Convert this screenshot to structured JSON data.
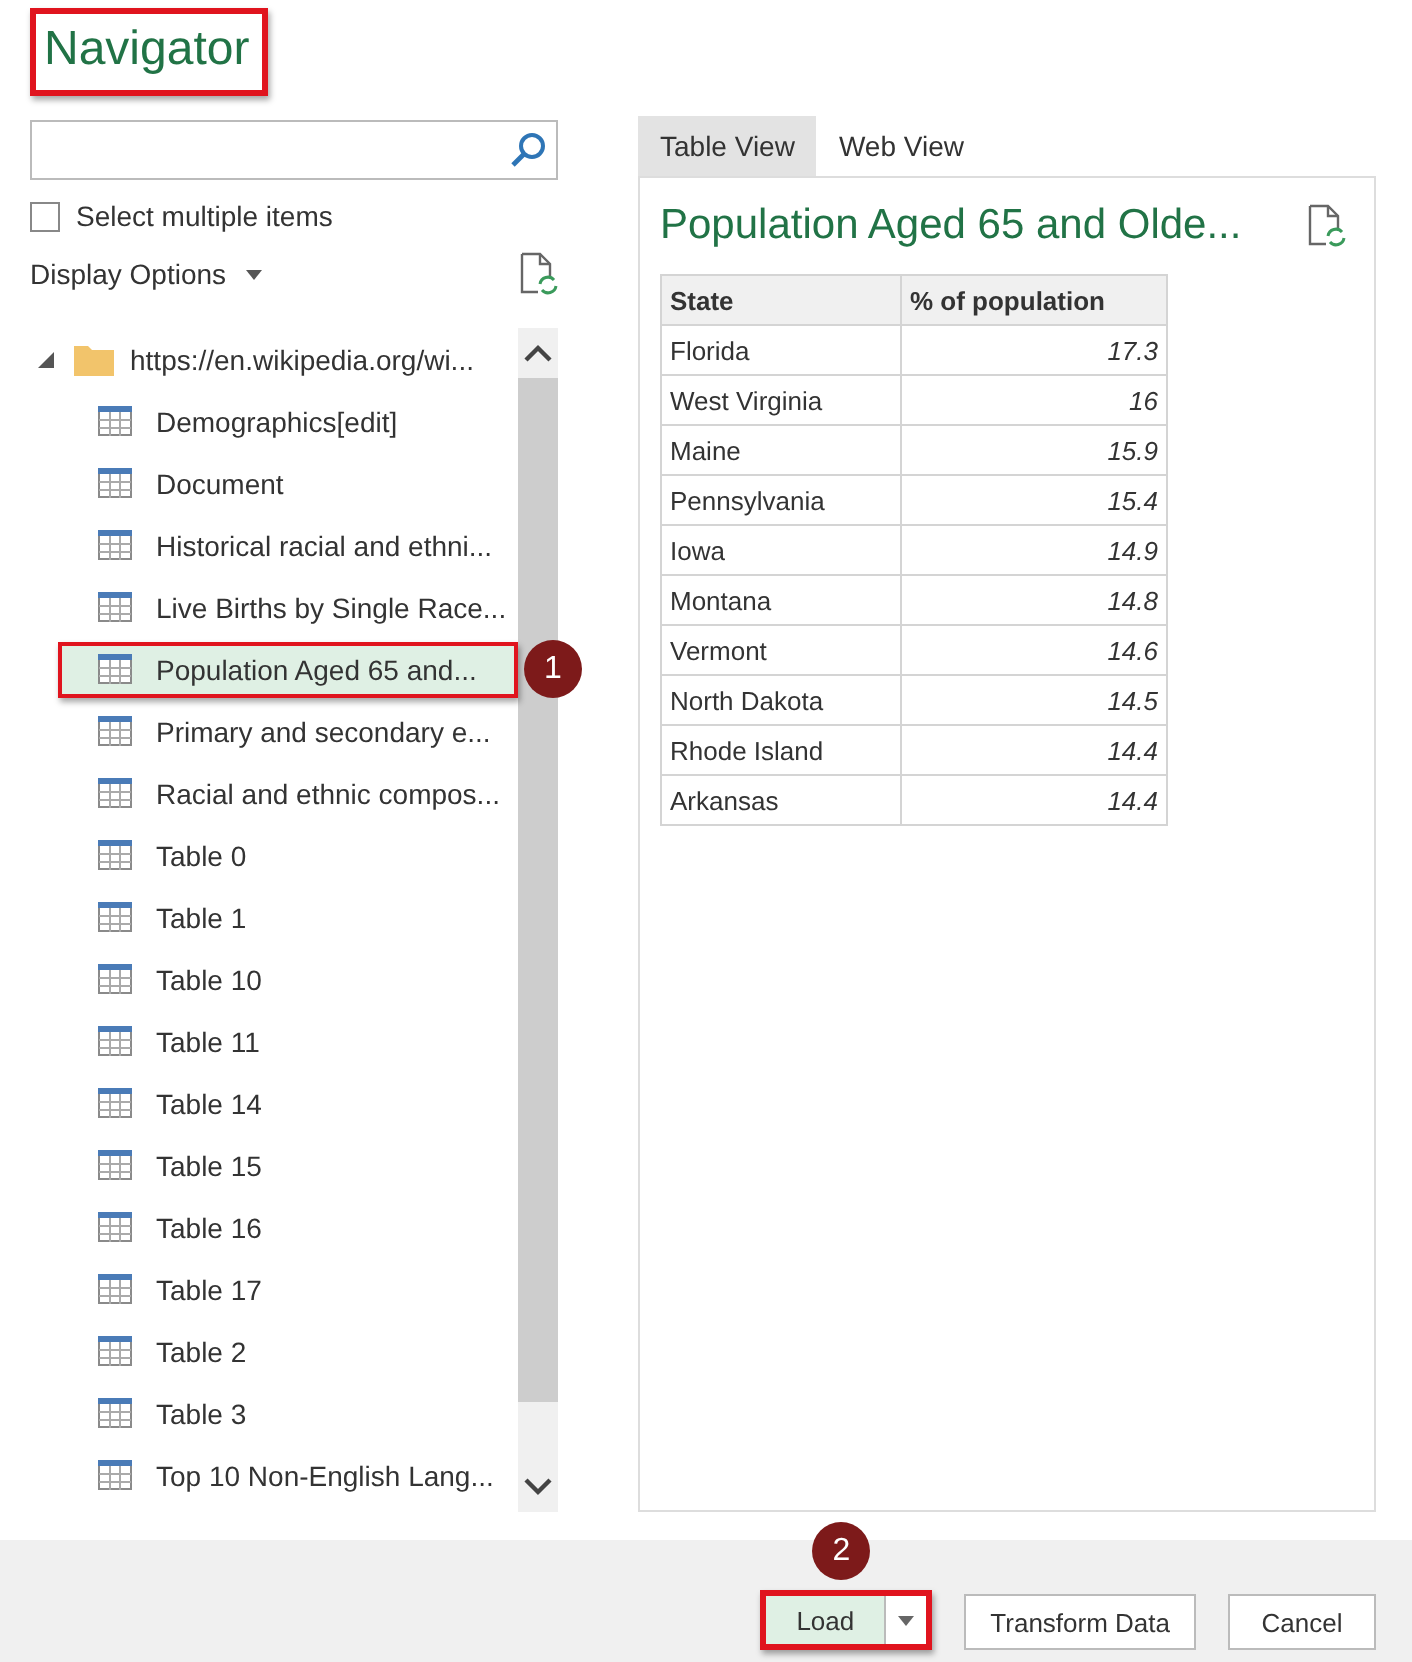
{
  "window": {
    "title": "Navigator",
    "title_highlighted": true
  },
  "select_multiple": {
    "label": "Select multiple items",
    "checked": false
  },
  "display_options": {
    "label": "Display Options"
  },
  "tree": {
    "label": "https://en.wikipedia.org/wi...",
    "expanded": true,
    "children": [
      {
        "label": "Demographics[edit]",
        "selected": false,
        "highlighted": false
      },
      {
        "label": "Document",
        "selected": false,
        "highlighted": false
      },
      {
        "label": "Historical racial and ethni...",
        "selected": false,
        "highlighted": false
      },
      {
        "label": "Live Births by Single Race...",
        "selected": false,
        "highlighted": false
      },
      {
        "label": "Population Aged 65 and...",
        "selected": true,
        "highlighted": true,
        "callout": "1"
      },
      {
        "label": "Primary and secondary e...",
        "selected": false,
        "highlighted": false
      },
      {
        "label": "Racial and ethnic compos...",
        "selected": false,
        "highlighted": false
      },
      {
        "label": "Table 0",
        "selected": false,
        "highlighted": false
      },
      {
        "label": "Table 1",
        "selected": false,
        "highlighted": false
      },
      {
        "label": "Table 10",
        "selected": false,
        "highlighted": false
      },
      {
        "label": "Table 11",
        "selected": false,
        "highlighted": false
      },
      {
        "label": "Table 14",
        "selected": false,
        "highlighted": false
      },
      {
        "label": "Table 15",
        "selected": false,
        "highlighted": false
      },
      {
        "label": "Table 16",
        "selected": false,
        "highlighted": false
      },
      {
        "label": "Table 17",
        "selected": false,
        "highlighted": false
      },
      {
        "label": "Table 2",
        "selected": false,
        "highlighted": false
      },
      {
        "label": "Table 3",
        "selected": false,
        "highlighted": false
      },
      {
        "label": "Top 10 Non-English Lang...",
        "selected": false,
        "highlighted": false
      }
    ]
  },
  "tabs": [
    {
      "label": "Table View",
      "selected": true
    },
    {
      "label": "Web View",
      "selected": false
    }
  ],
  "preview": {
    "title": "Population Aged 65 and Olde...",
    "columns": [
      "State",
      "% of population"
    ],
    "rows": [
      [
        "Florida",
        "17.3"
      ],
      [
        "West Virginia",
        "16"
      ],
      [
        "Maine",
        "15.9"
      ],
      [
        "Pennsylvania",
        "15.4"
      ],
      [
        "Iowa",
        "14.9"
      ],
      [
        "Montana",
        "14.8"
      ],
      [
        "Vermont",
        "14.6"
      ],
      [
        "North Dakota",
        "14.5"
      ],
      [
        "Rhode Island",
        "14.4"
      ],
      [
        "Arkansas",
        "14.4"
      ]
    ]
  },
  "buttons": [
    {
      "kind": "split",
      "label": "Load",
      "highlighted": true,
      "callout": "2"
    },
    {
      "kind": "plain",
      "label": "Transform Data",
      "highlighted": false
    },
    {
      "kind": "plain",
      "label": "Cancel",
      "highlighted": false
    }
  ]
}
